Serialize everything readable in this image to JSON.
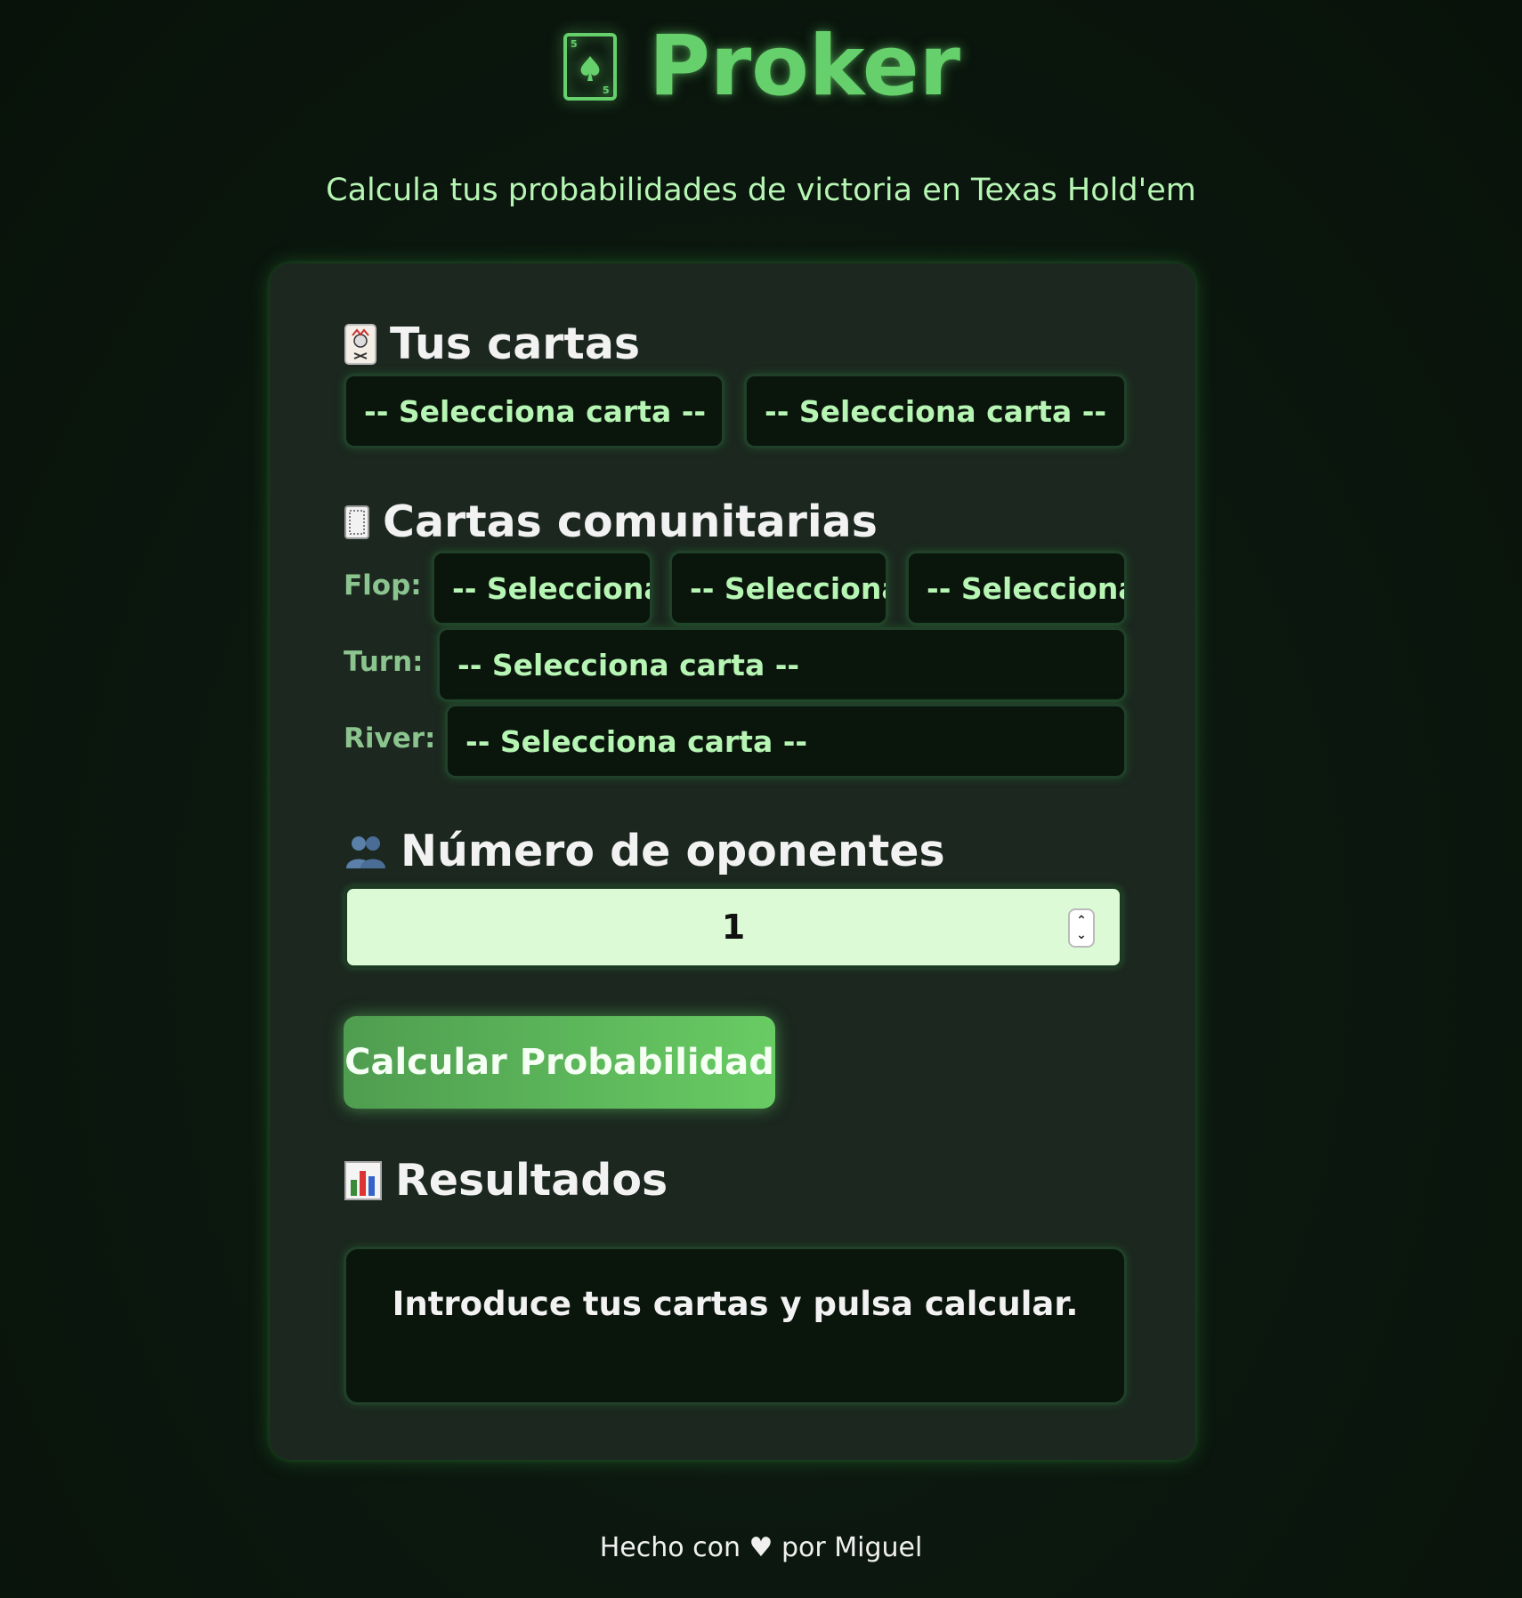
{
  "header": {
    "title": "Proker",
    "title_icon": "spade-card-icon",
    "subtitle": "Calcula tus probabilidades de victoria en Texas Hold'em"
  },
  "your_cards": {
    "title": "Tus cartas",
    "icon": "joker-card-icon",
    "select1": "-- Selecciona carta --",
    "select2": "-- Selecciona carta --"
  },
  "community": {
    "title": "Cartas comunitarias",
    "icon": "card-back-icon",
    "flop_label": "Flop:",
    "flop": [
      "-- Selecciona carta --",
      "-- Selecciona carta --",
      "-- Selecciona carta --"
    ],
    "turn_label": "Turn:",
    "turn": "-- Selecciona carta --",
    "river_label": "River:",
    "river": "-- Selecciona carta --"
  },
  "opponents": {
    "title": "Número de oponentes",
    "icon": "two-people-icon",
    "value": "1"
  },
  "calculate_button": "Calcular Probabilidad",
  "results": {
    "title": "Resultados",
    "icon": "bar-chart-icon",
    "message": "Introduce tus cartas y pulsa calcular."
  },
  "footer": {
    "text_before": "Hecho con",
    "heart": "♥",
    "text_after": "por Miguel"
  },
  "colors": {
    "accent": "#66d06c",
    "background": "#0c180f",
    "panel": "#1b271f",
    "select_text": "#b6f5b3"
  }
}
